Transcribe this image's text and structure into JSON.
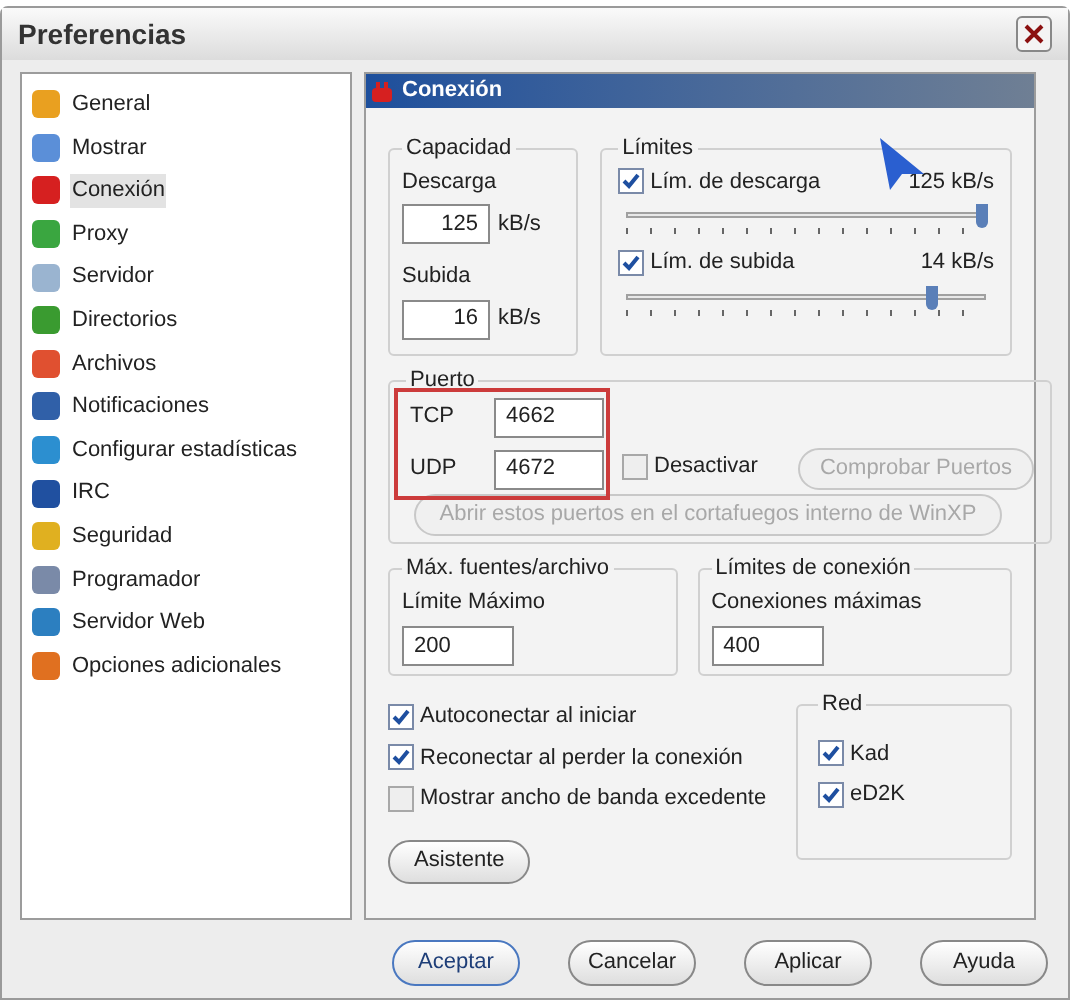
{
  "window": {
    "title": "Preferencias"
  },
  "sidebar": {
    "items": [
      {
        "label": "General",
        "selected": false
      },
      {
        "label": "Mostrar",
        "selected": false
      },
      {
        "label": "Conexión",
        "selected": true
      },
      {
        "label": "Proxy",
        "selected": false
      },
      {
        "label": "Servidor",
        "selected": false
      },
      {
        "label": "Directorios",
        "selected": false
      },
      {
        "label": "Archivos",
        "selected": false
      },
      {
        "label": "Notificaciones",
        "selected": false
      },
      {
        "label": "Configurar estadísticas",
        "selected": false
      },
      {
        "label": "IRC",
        "selected": false
      },
      {
        "label": "Seguridad",
        "selected": false
      },
      {
        "label": "Programador",
        "selected": false
      },
      {
        "label": "Servidor Web",
        "selected": false
      },
      {
        "label": "Opciones adicionales",
        "selected": false
      }
    ]
  },
  "panel": {
    "title": "Conexión",
    "capacity": {
      "title": "Capacidad",
      "fields": [
        {
          "label": "Descarga",
          "value": "125",
          "unit": "kB/s"
        },
        {
          "label": "Subida",
          "value": "16",
          "unit": "kB/s"
        }
      ]
    },
    "limits": {
      "title": "Límites",
      "sliders": [
        {
          "label": "Lím. de descarga",
          "checked": true,
          "reading": "125 kB/s",
          "level": 0.99
        },
        {
          "label": "Lím. de subida",
          "checked": true,
          "reading": "14 kB/s",
          "level": 0.85
        }
      ]
    },
    "port": {
      "title": "Puerto",
      "fields": [
        {
          "label": "TCP",
          "value": "4662"
        },
        {
          "label": "UDP",
          "value": "4672"
        }
      ],
      "disable": {
        "label": "Desactivar",
        "checked": false
      },
      "check_button": {
        "label": "Comprobar Puertos",
        "disabled": true
      },
      "firewall_button": {
        "label": "Abrir estos puertos en el cortafuegos interno de WinXP",
        "disabled": true
      }
    },
    "max_sources": {
      "title": "Máx. fuentes/archivo",
      "label": "Límite Máximo",
      "value": "200"
    },
    "connection_limits": {
      "title": "Límites de conexión",
      "label": "Conexiones máximas",
      "value": "400"
    },
    "options": [
      {
        "label": "Autoconectar al iniciar",
        "checked": true
      },
      {
        "label": "Reconectar al perder la conexión",
        "checked": true
      },
      {
        "label": "Mostrar ancho de banda excedente",
        "checked": false
      }
    ],
    "wizard_button": "Asistente",
    "network": {
      "title": "Red",
      "items": [
        {
          "label": "Kad",
          "checked": true
        },
        {
          "label": "eD2K",
          "checked": true
        }
      ]
    }
  },
  "buttons": [
    {
      "label": "Aceptar",
      "default": true
    },
    {
      "label": "Cancelar",
      "default": false
    },
    {
      "label": "Aplicar",
      "default": false
    },
    {
      "label": "Ayuda",
      "default": false
    }
  ]
}
